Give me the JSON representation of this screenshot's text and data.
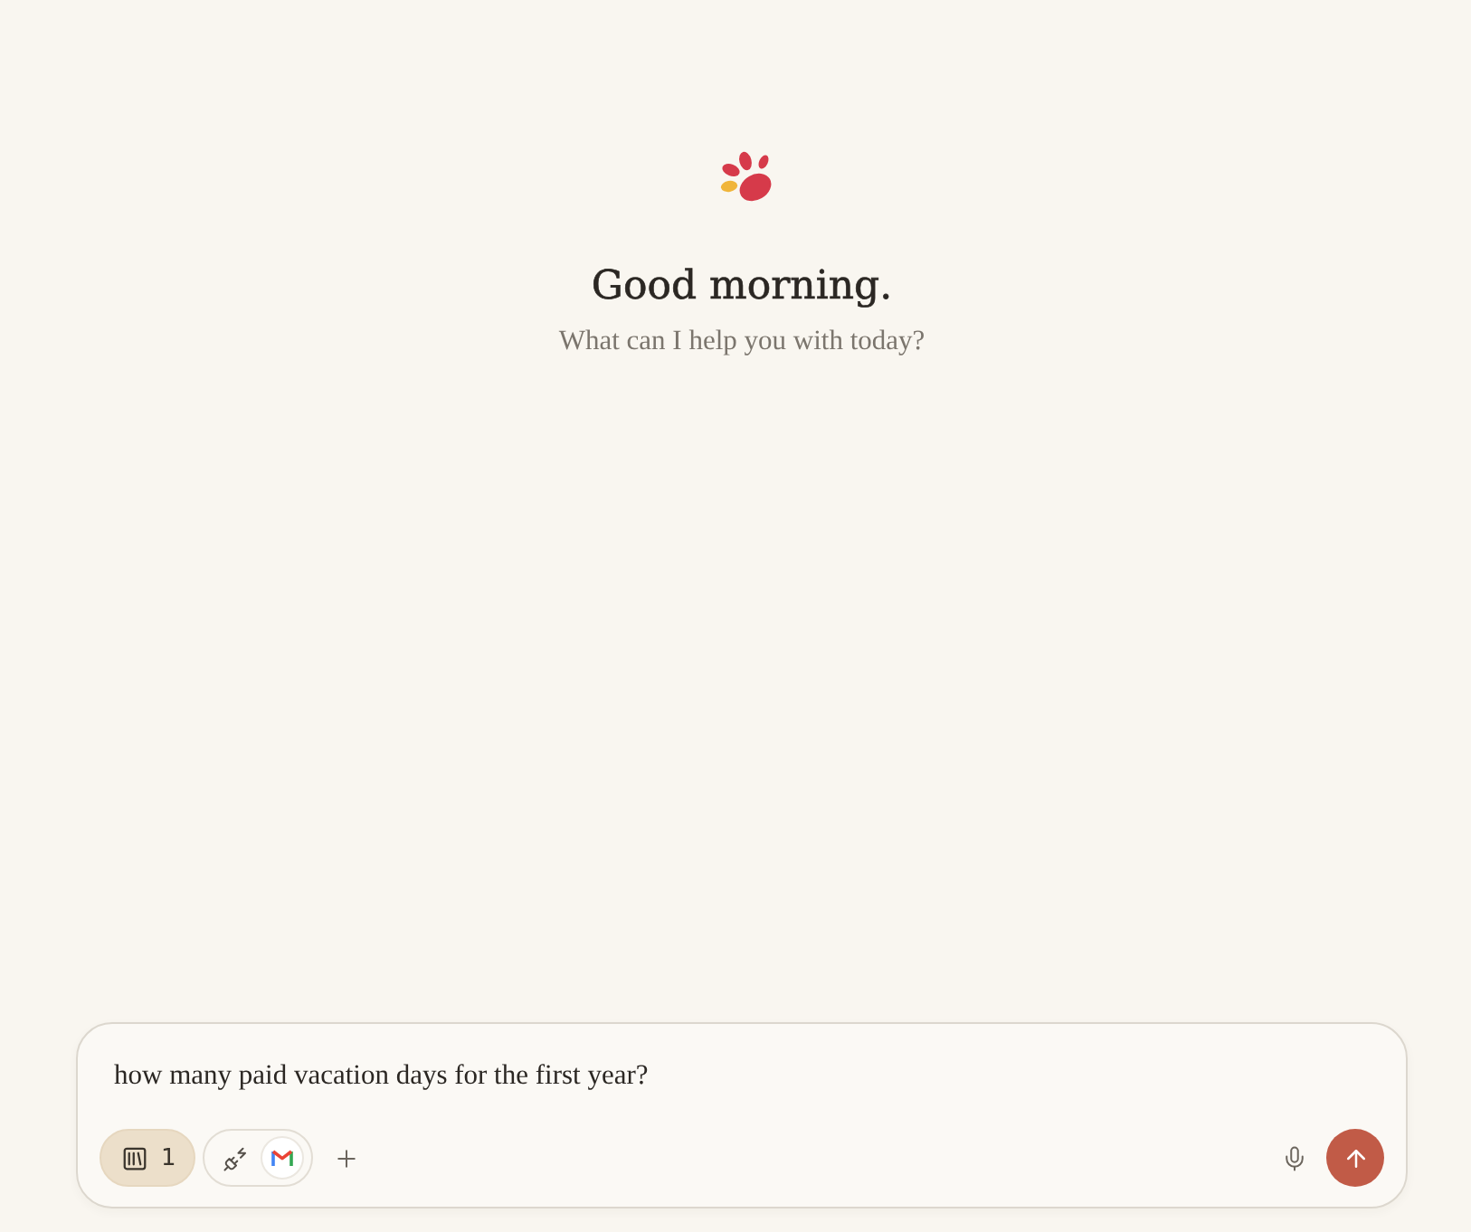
{
  "greeting": {
    "title": "Good morning.",
    "subtitle": "What can I help you with today?"
  },
  "composer": {
    "value": "how many paid vacation days for the first year?",
    "project_button": {
      "count": "1",
      "active": true
    },
    "send_button": {
      "disabled": false
    }
  }
}
